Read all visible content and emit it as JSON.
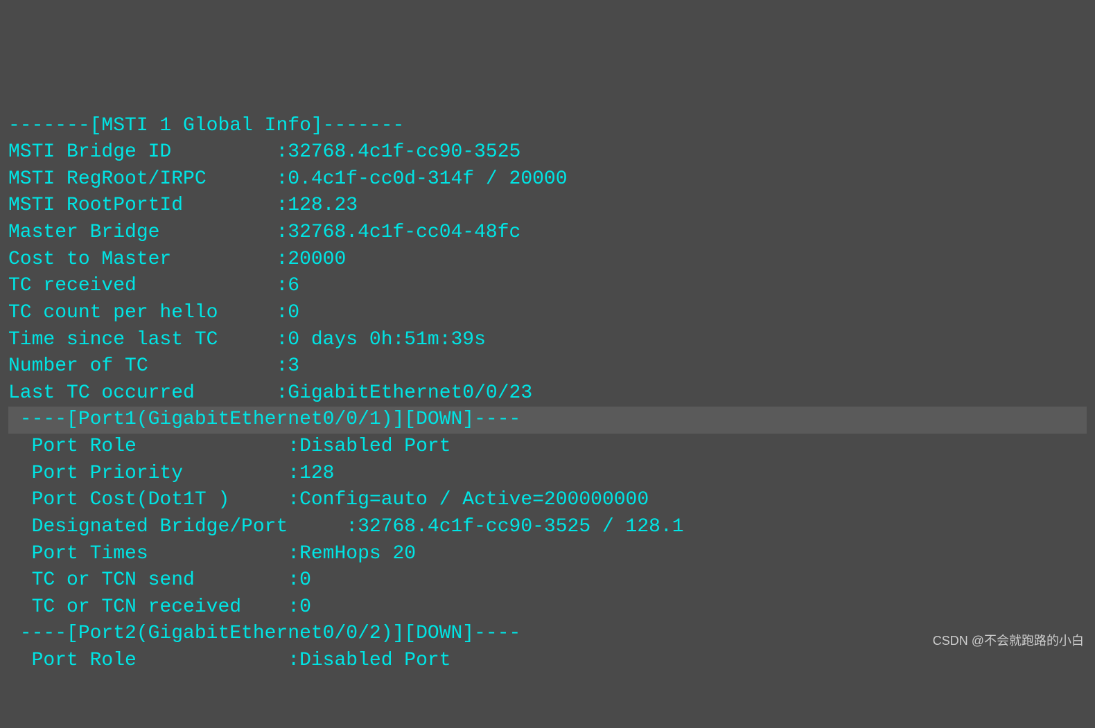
{
  "terminal": {
    "lines": [
      "-------[MSTI 1 Global Info]-------",
      "MSTI Bridge ID         :32768.4c1f-cc90-3525",
      "MSTI RegRoot/IRPC      :0.4c1f-cc0d-314f / 20000",
      "MSTI RootPortId        :128.23",
      "Master Bridge          :32768.4c1f-cc04-48fc",
      "Cost to Master         :20000",
      "TC received            :6",
      "TC count per hello     :0",
      "Time since last TC     :0 days 0h:51m:39s",
      "Number of TC           :3",
      "Last TC occurred       :GigabitEthernet0/0/23",
      " ----[Port1(GigabitEthernet0/0/1)][DOWN]----",
      "  Port Role             :Disabled Port",
      "  Port Priority         :128",
      "  Port Cost(Dot1T )     :Config=auto / Active=200000000",
      "  Designated Bridge/Port     :32768.4c1f-cc90-3525 / 128.1",
      "  Port Times            :RemHops 20",
      "  TC or TCN send        :0",
      "  TC or TCN received    :0",
      " ----[Port2(GigabitEthernet0/0/2)][DOWN]----",
      "  Port Role             :Disabled Port"
    ],
    "highlighted_lines": [
      11
    ],
    "watermark": "CSDN @不会就跑路的小白"
  }
}
